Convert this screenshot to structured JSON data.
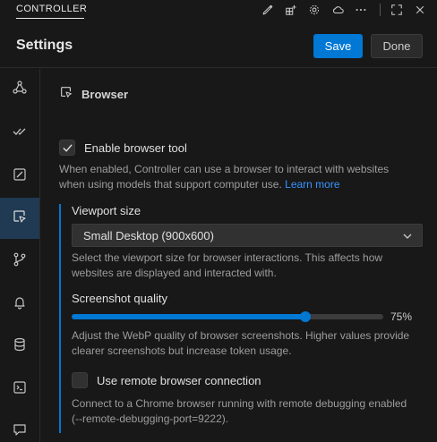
{
  "topbar": {
    "tab_label": "CONTROLLER",
    "icons": [
      "pencil-icon",
      "add-extension-icon",
      "gear-icon",
      "cloud-icon",
      "more-icon",
      "fullscreen-icon",
      "close-icon"
    ]
  },
  "header": {
    "title": "Settings",
    "save_label": "Save",
    "done_label": "Done"
  },
  "sidebar": {
    "items": [
      {
        "icon": "webhook-icon",
        "active": false
      },
      {
        "icon": "double-check-icon",
        "active": false
      },
      {
        "icon": "edit-box-icon",
        "active": false
      },
      {
        "icon": "browser-cursor-icon",
        "active": true
      },
      {
        "icon": "git-branch-icon",
        "active": false
      },
      {
        "icon": "bell-icon",
        "active": false
      },
      {
        "icon": "database-icon",
        "active": false
      },
      {
        "icon": "terminal-icon",
        "active": false
      },
      {
        "icon": "chat-icon",
        "active": false
      }
    ]
  },
  "browser": {
    "section_title": "Browser",
    "enable_label": "Enable browser tool",
    "enable_checked": true,
    "enable_desc_line1": "When enabled, Controller can use a browser to interact with websites",
    "enable_desc_line2": "when using models that support computer use.",
    "learn_more": "Learn more",
    "viewport_label": "Viewport size",
    "viewport_value": "Small Desktop (900x600)",
    "viewport_desc_line1": "Select the viewport size for browser interactions. This affects how",
    "viewport_desc_line2": "websites are displayed and interacted with.",
    "quality_label": "Screenshot quality",
    "quality_value": 75,
    "quality_display": "75%",
    "quality_desc_line1": "Adjust the WebP quality of browser screenshots. Higher values provide",
    "quality_desc_line2": "clearer screenshots but increase token usage.",
    "remote_label": "Use remote browser connection",
    "remote_checked": false,
    "remote_desc_line1": "Connect to a Chrome browser running with remote debugging enabled",
    "remote_desc_line2": "(--remote-debugging-port=9222)."
  },
  "colors": {
    "accent": "#0078d4",
    "link": "#3794ff",
    "background": "#181818",
    "sidebar_active": "#1f3a52"
  }
}
